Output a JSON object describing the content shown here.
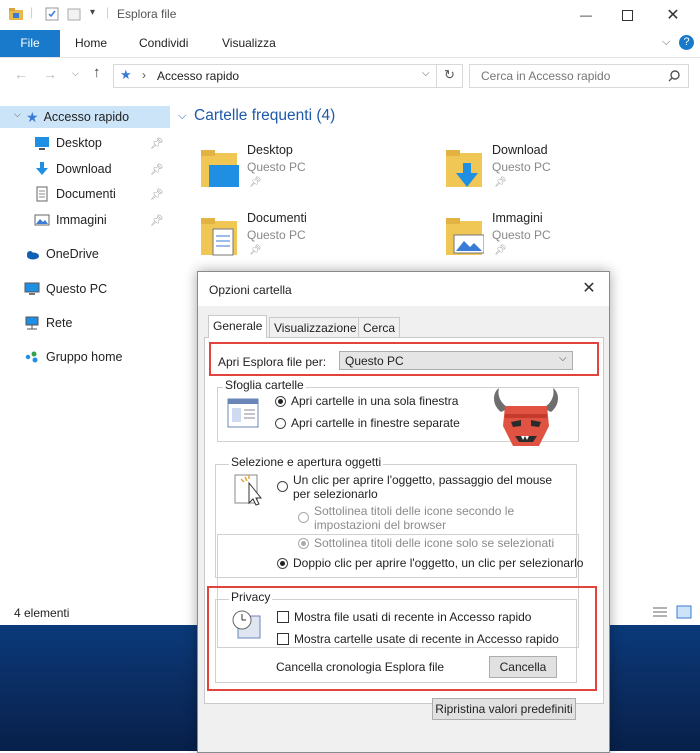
{
  "explorer": {
    "window_title": "Esplora file",
    "ribbon_tabs": [
      "File",
      "Home",
      "Condividi",
      "Visualizza"
    ],
    "address": {
      "path": "Accesso rapido"
    },
    "search": {
      "placeholder": "Cerca in Accesso rapido"
    },
    "sidebar": {
      "items": [
        {
          "label": "Accesso rapido",
          "icon": "star-icon",
          "selected": true
        },
        {
          "label": "Desktop",
          "icon": "desktop-icon",
          "pinned": true
        },
        {
          "label": "Download",
          "icon": "download-icon",
          "pinned": true
        },
        {
          "label": "Documenti",
          "icon": "documents-icon",
          "pinned": true
        },
        {
          "label": "Immagini",
          "icon": "pictures-icon",
          "pinned": true
        },
        {
          "label": "OneDrive",
          "icon": "cloud-icon"
        },
        {
          "label": "Questo PC",
          "icon": "pc-icon"
        },
        {
          "label": "Rete",
          "icon": "network-icon"
        },
        {
          "label": "Gruppo home",
          "icon": "homegroup-icon"
        }
      ]
    },
    "content": {
      "section_title": "Cartelle frequenti (4)",
      "folders": [
        {
          "name": "Desktop",
          "location": "Questo PC",
          "icon": "folder-desktop-icon"
        },
        {
          "name": "Download",
          "location": "Questo PC",
          "icon": "folder-download-icon"
        },
        {
          "name": "Documenti",
          "location": "Questo PC",
          "icon": "folder-documents-icon"
        },
        {
          "name": "Immagini",
          "location": "Questo PC",
          "icon": "folder-pictures-icon"
        }
      ]
    },
    "status": {
      "count": "4 elementi"
    }
  },
  "dialog": {
    "title": "Opzioni cartella",
    "tabs": [
      "Generale",
      "Visualizzazione",
      "Cerca"
    ],
    "open_in": {
      "label": "Apri Esplora file per:",
      "value": "Questo PC"
    },
    "browse": {
      "title": "Sfoglia cartelle",
      "options": [
        "Apri cartelle in una sola finestra",
        "Apri cartelle in finestre separate"
      ]
    },
    "click": {
      "title": "Selezione e apertura oggetti",
      "single_line1": "Un clic per aprire l'oggetto, passaggio del mouse",
      "single_line2": "per selezionarlo",
      "underline_browser_line1": "Sottolinea titoli delle icone secondo le",
      "underline_browser_line2": "impostazioni del browser",
      "underline_select": "Sottolinea titoli delle icone solo se selezionati",
      "double": "Doppio clic per aprire l'oggetto, un clic per selezionarlo"
    },
    "privacy": {
      "title": "Privacy",
      "recent_files": "Mostra file usati di recente in Accesso rapido",
      "recent_folders": "Mostra cartelle usate di recente in Accesso rapido",
      "clear_label": "Cancella cronologia Esplora file",
      "clear_button": "Cancella"
    },
    "restore_button": "Ripristina valori predefiniti"
  },
  "colors": {
    "accent": "#1979ca",
    "highlight_box": "#e0443c",
    "selected_nav": "#cce4f7"
  }
}
